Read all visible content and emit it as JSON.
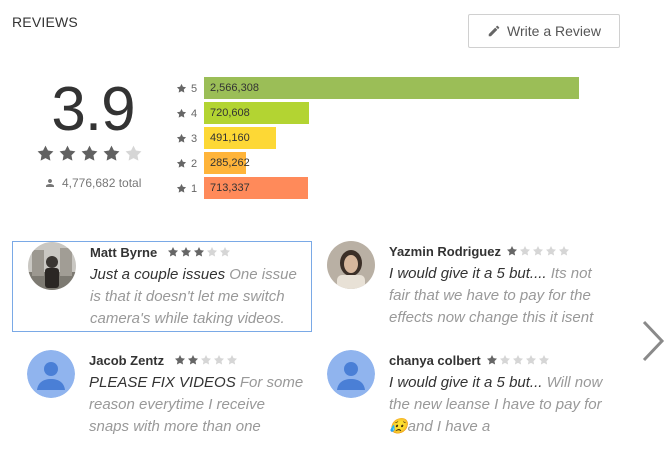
{
  "header": {
    "title": "REVIEWS",
    "write_label": "Write a Review"
  },
  "summary": {
    "score": "3.9",
    "stars_filled": 4,
    "total": "4,776,682 total"
  },
  "histogram": [
    {
      "stars": "5",
      "count": "2,566,308",
      "share": 1.0,
      "color": "#9bbe57"
    },
    {
      "stars": "4",
      "count": "720,608",
      "share": 0.281,
      "color": "#b3d432"
    },
    {
      "stars": "3",
      "count": "491,160",
      "share": 0.191,
      "color": "#fdd835"
    },
    {
      "stars": "2",
      "count": "285,262",
      "share": 0.111,
      "color": "#ffb43a"
    },
    {
      "stars": "1",
      "count": "713,337",
      "share": 0.278,
      "color": "#ff8a5a"
    }
  ],
  "reviews": [
    {
      "author": "Matt Byrne",
      "stars": 3,
      "title": "Just a couple issues",
      "body": "One issue is that it doesn't let me switch camera's while taking videos.",
      "avatar": "photo-man"
    },
    {
      "author": "Yazmin Rodriguez",
      "stars": 1,
      "title": "I would give it a 5 but....",
      "body": "Its not fair that we have to pay for the effects now change this it isent",
      "avatar": "photo-woman"
    },
    {
      "author": "Jacob Zentz",
      "stars": 2,
      "title": "PLEASE FIX VIDEOS",
      "body": "For some reason everytime I receive snaps with more than one",
      "avatar": "default-avatar"
    },
    {
      "author": "chanya colbert",
      "stars": 1,
      "title": "I would give it a 5 but...",
      "body": "Will now the new leanse I have to pay for😥and I have a",
      "avatar": "default-avatar"
    }
  ],
  "colors": {
    "star_filled": "#616161",
    "star_empty": "#d6d6d6",
    "selected_border": "#7aa9e6",
    "avatar_bg": "#90b4ee",
    "avatar_fg": "#4a7fd6"
  },
  "icons": {
    "write": "pencil-icon",
    "total": "person-icon",
    "next": "chevron-right-icon"
  }
}
